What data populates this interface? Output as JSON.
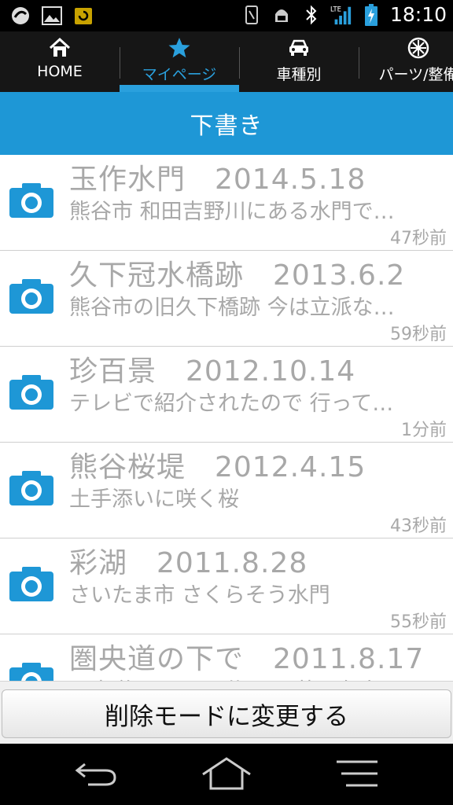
{
  "status_bar": {
    "time": "18:10",
    "network_label": "LTE"
  },
  "tabs": [
    {
      "label": "HOME",
      "icon": "home-icon",
      "active": false
    },
    {
      "label": "マイページ",
      "icon": "star-icon",
      "active": true
    },
    {
      "label": "車種別",
      "icon": "car-icon",
      "active": false
    },
    {
      "label": "パーツ/整備",
      "icon": "wheel-icon",
      "active": false
    }
  ],
  "header": {
    "title": "下書き"
  },
  "drafts": [
    {
      "title": "玉作水門　2014.5.18",
      "description": "熊谷市 和田吉野川にある水門で…",
      "time": "47秒前"
    },
    {
      "title": "久下冠水橋跡　2013.6.2",
      "description": "熊谷市の旧久下橋跡 今は立派な…",
      "time": "59秒前"
    },
    {
      "title": "珍百景　2012.10.14",
      "description": "テレビで紹介されたので 行って…",
      "time": "1分前"
    },
    {
      "title": "熊谷桜堤　2012.4.15",
      "description": "土手添いに咲く桜",
      "time": "43秒前"
    },
    {
      "title": "彩湖　2011.8.28",
      "description": "さいたま市 さくらそう水門",
      "time": "55秒前"
    },
    {
      "title": "圏央道の下で　2011.8.17",
      "description": "圏央道の下で… 休み… 荒川左岸",
      "time": ""
    }
  ],
  "footer": {
    "delete_mode_label": "削除モードに変更する"
  },
  "colors": {
    "accent": "#1e97d6",
    "muted_text": "#a8a8a8"
  }
}
